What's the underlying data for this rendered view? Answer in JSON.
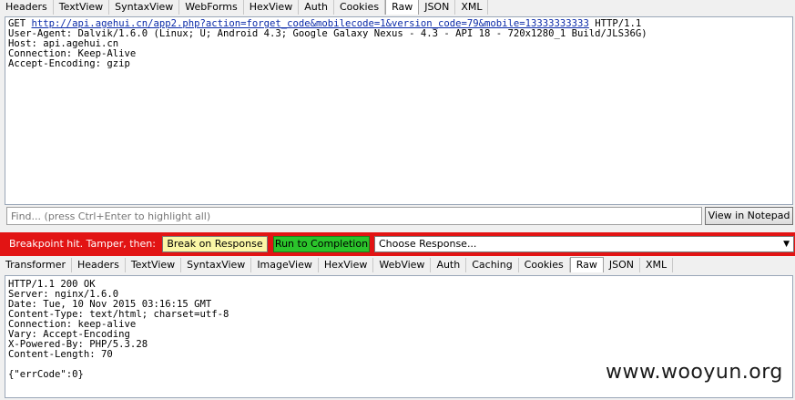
{
  "request_tabs": [
    "Headers",
    "TextView",
    "SyntaxView",
    "WebForms",
    "HexView",
    "Auth",
    "Cookies",
    "Raw",
    "JSON",
    "XML"
  ],
  "request_active_tab": "Raw",
  "request": {
    "method": "GET",
    "url": "http://api.agehui.cn/app2.php?action=forget_code&mobilecode=1&version_code=79&mobile=13333333333",
    "protocol": "HTTP/1.1",
    "headers": [
      "User-Agent: Dalvik/1.6.0 (Linux; U; Android 4.3; Google Galaxy Nexus - 4.3 - API 18 - 720x1280_1 Build/JLS36G)",
      "Host: api.agehui.cn",
      "Connection: Keep-Alive",
      "Accept-Encoding: gzip"
    ]
  },
  "find": {
    "placeholder": "Find... (press Ctrl+Enter to highlight all)",
    "view_notepad_label": "View in Notepad"
  },
  "breakpoint": {
    "label": "Breakpoint hit. Tamper, then:",
    "break_on_response": "Break on Response",
    "run_to_completion": "Run to Completion",
    "choose_response": "Choose Response..."
  },
  "response_tabs": [
    "Transformer",
    "Headers",
    "TextView",
    "SyntaxView",
    "ImageView",
    "HexView",
    "WebView",
    "Auth",
    "Caching",
    "Cookies",
    "Raw",
    "JSON",
    "XML"
  ],
  "response_active_tab": "Raw",
  "response": {
    "lines": [
      "HTTP/1.1 200 OK",
      "Server: nginx/1.6.0",
      "Date: Tue, 10 Nov 2015 03:16:15 GMT",
      "Content-Type: text/html; charset=utf-8",
      "Connection: keep-alive",
      "Vary: Accept-Encoding",
      "X-Powered-By: PHP/5.3.28",
      "Content-Length: 70",
      "",
      "{\"errCode\":0}"
    ]
  },
  "watermark": "www.wooyun.org",
  "colors": {
    "breakpoint_bar": "#e21414",
    "break_button": "#fbf7a6",
    "run_button": "#2bc42b",
    "link": "#0a2aa8"
  }
}
